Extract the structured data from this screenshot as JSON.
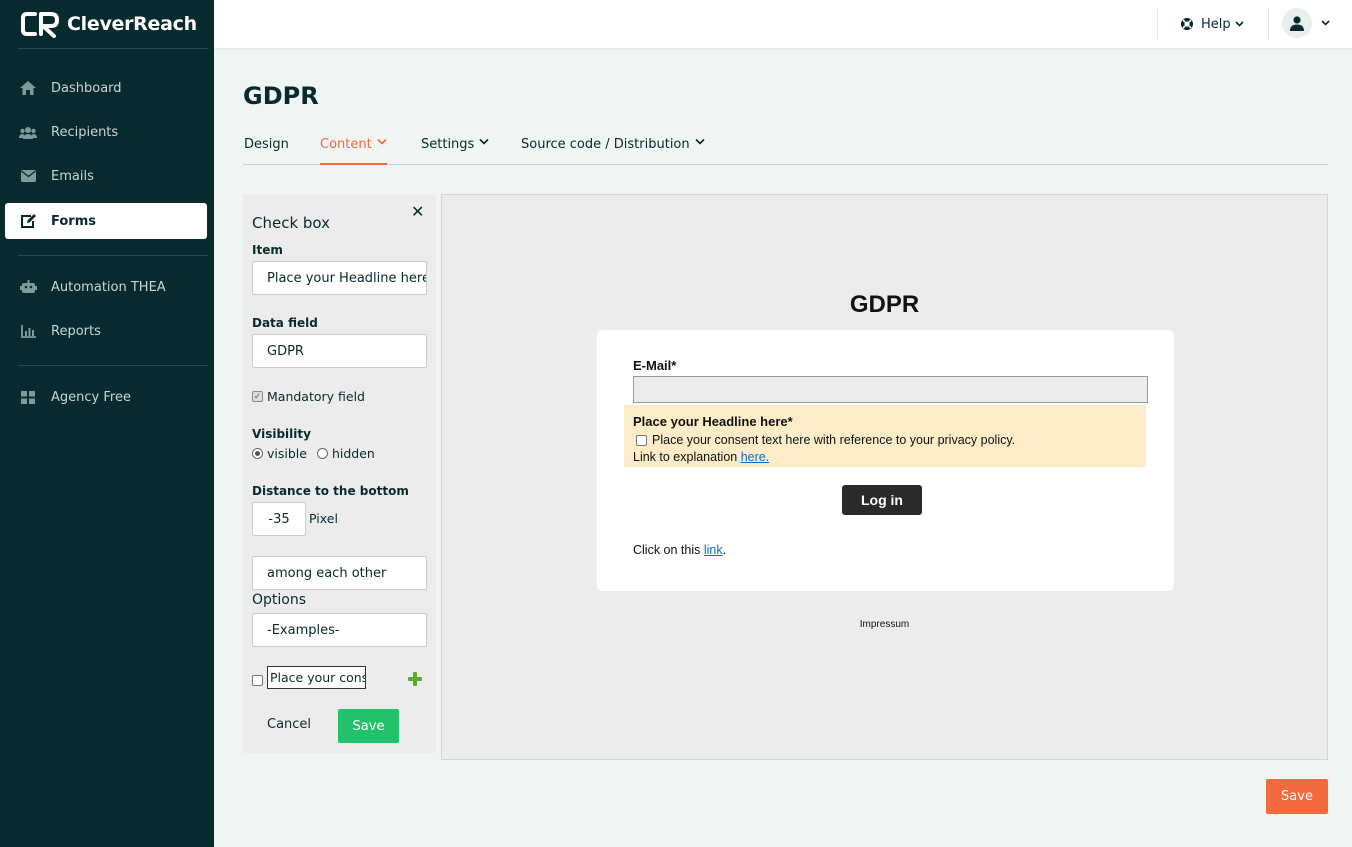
{
  "app": {
    "logo_text": "CleverReach"
  },
  "sidebar": {
    "items": [
      {
        "label": "Dashboard",
        "icon": "home-icon"
      },
      {
        "label": "Recipients",
        "icon": "users-icon"
      },
      {
        "label": "Emails",
        "icon": "envelope-icon"
      },
      {
        "label": "Forms",
        "icon": "edit-icon",
        "active": true
      },
      {
        "label": "Automation THEA",
        "icon": "robot-icon"
      },
      {
        "label": "Reports",
        "icon": "chart-icon"
      },
      {
        "label": "Agency Free",
        "icon": "grid-icon"
      }
    ]
  },
  "topbar": {
    "help_label": "Help"
  },
  "page": {
    "title": "GDPR"
  },
  "tabs": [
    {
      "label": "Design"
    },
    {
      "label": "Content",
      "active": true
    },
    {
      "label": "Settings"
    },
    {
      "label": "Source code / Distribution"
    }
  ],
  "editor": {
    "title": "Check box",
    "item_label": "Item",
    "item_value": "Place your Headline here*",
    "data_field_label": "Data field",
    "data_field_value": "GDPR",
    "mandatory_label": "Mandatory field",
    "visibility_label": "Visibility",
    "visible_label": "visible",
    "hidden_label": "hidden",
    "distance_label": "Distance to the bottom",
    "distance_value": "-35",
    "distance_unit": "Pixel",
    "arrangement_value": "among each other",
    "options_label": "Options",
    "options_select": "-Examples-",
    "option_text": "Place your consent text here",
    "cancel_label": "Cancel",
    "save_label": "Save"
  },
  "preview": {
    "title": "GDPR",
    "email_label": "E-Mail*",
    "consent_headline": "Place your Headline here*",
    "consent_text": "Place your consent text here with reference to your privacy policy.",
    "explanation_prefix": "Link to explanation ",
    "explanation_link": "here.",
    "login_button": "Log in",
    "click_prefix": "Click on this ",
    "click_link": "link",
    "click_suffix": ".",
    "impressum": "Impressum"
  },
  "footer": {
    "save_label": "Save"
  },
  "colors": {
    "sidebar_bg": "#072a2f",
    "accent": "#f26a3d",
    "success": "#22c16b",
    "consent_bg": "#fdecc8"
  }
}
